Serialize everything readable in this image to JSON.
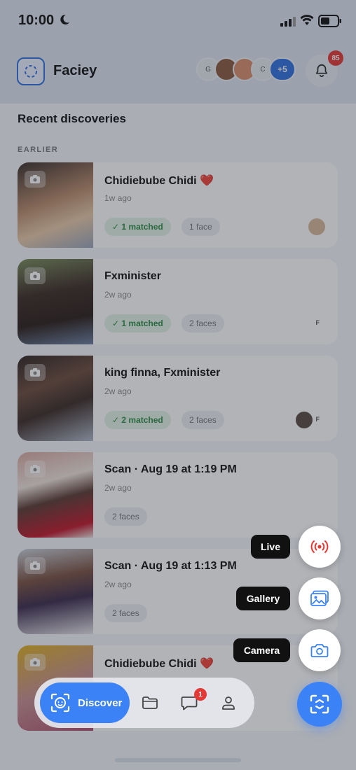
{
  "status_bar": {
    "time": "10:00"
  },
  "header": {
    "brand": "Faciey",
    "avatars": [
      "G",
      "",
      "",
      "C"
    ],
    "avatars_more": "+5",
    "notifications_count": "85"
  },
  "section_title": "Recent discoveries",
  "group_label": "EARLIER",
  "cards": [
    {
      "title": "Chidiebube Chidi ❤️",
      "time": "1w ago",
      "matched": "✓ 1 matched",
      "faces": "1 face",
      "mini_letter": ""
    },
    {
      "title": "Fxminister",
      "time": "2w ago",
      "matched": "✓ 1 matched",
      "faces": "2 faces",
      "mini_letter": "F"
    },
    {
      "title": "king finna, Fxminister",
      "time": "2w ago",
      "matched": "✓ 2 matched",
      "faces": "2 faces",
      "mini_letter": "F"
    },
    {
      "title": "Scan · Aug 19 at 1:19 PM",
      "time": "2w ago",
      "matched": "",
      "faces": "2 faces",
      "mini_letter": ""
    },
    {
      "title": "Scan · Aug 19 at 1:13 PM",
      "time": "2w ago",
      "matched": "",
      "faces": "2 faces",
      "mini_letter": ""
    },
    {
      "title": "Chidiebube Chidi ❤️",
      "time": "",
      "matched": "",
      "faces": "",
      "mini_letter": ""
    }
  ],
  "actions": {
    "live": "Live",
    "gallery": "Gallery",
    "camera": "Camera"
  },
  "nav": {
    "discover": "Discover",
    "messages_badge": "1"
  },
  "colors": {
    "accent": "#3b82f6",
    "badge": "#e53935",
    "match_green": "#2e8b45",
    "live_red": "#e53935"
  },
  "icons": [
    "moon-icon",
    "signal-icon",
    "wifi-icon",
    "battery-icon",
    "bell-icon",
    "camera-icon",
    "folder-icon",
    "chat-icon",
    "profile-icon",
    "scan-icon",
    "live-icon",
    "gallery-icon",
    "face-scan-icon"
  ]
}
